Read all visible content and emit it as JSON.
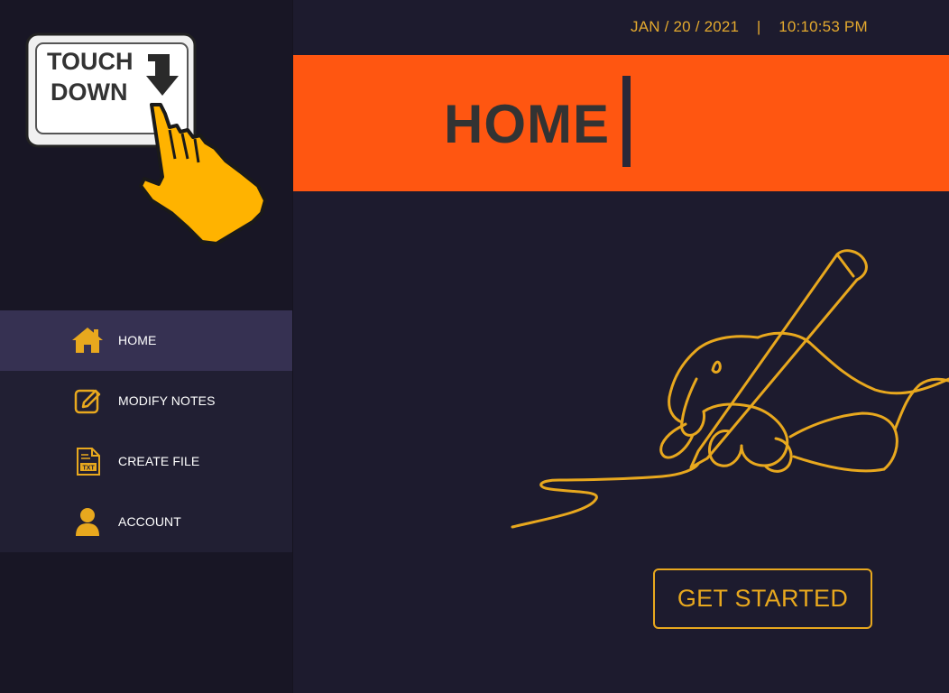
{
  "logo": {
    "line1": "TOUCH",
    "line2": "DOWN"
  },
  "header": {
    "date": "JAN / 20 / 2021",
    "separator": "|",
    "time": "10:10:53 PM"
  },
  "page": {
    "title": "HOME"
  },
  "nav": {
    "items": [
      {
        "label": "HOME",
        "icon": "home-icon",
        "active": true
      },
      {
        "label": "MODIFY NOTES",
        "icon": "edit-icon",
        "active": false
      },
      {
        "label": "CREATE FILE",
        "icon": "txt-file-icon",
        "active": false
      },
      {
        "label": "ACCOUNT",
        "icon": "user-icon",
        "active": false
      }
    ]
  },
  "cta": {
    "label": "GET STARTED"
  },
  "colors": {
    "accent": "#e8a81e",
    "banner": "#ff5611",
    "background": "#1d1b2e",
    "sidebar": "#181625",
    "nav_active": "#363152"
  }
}
